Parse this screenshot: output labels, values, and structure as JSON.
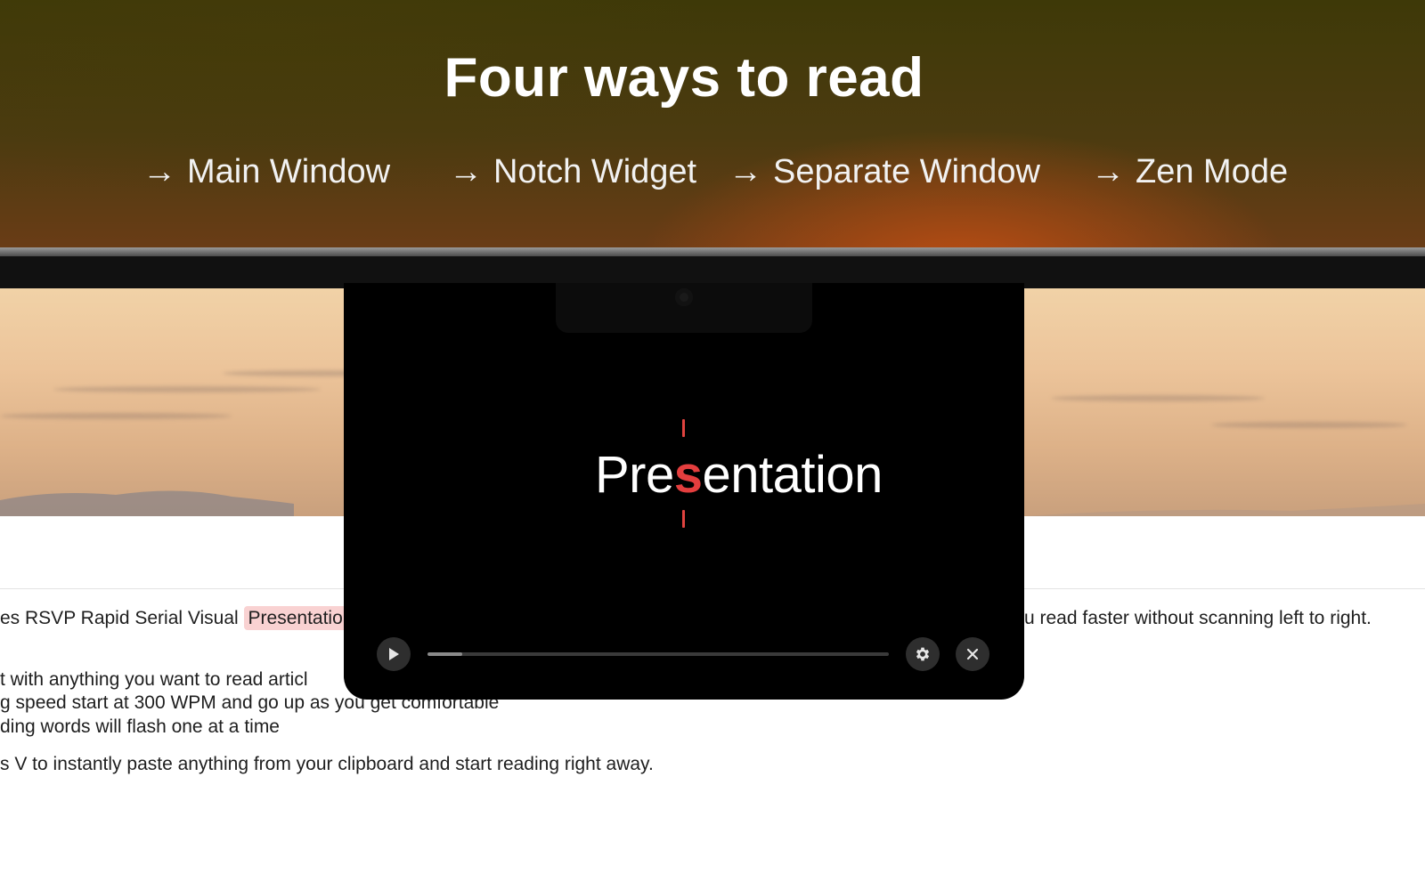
{
  "hero": {
    "title": "Four ways to read",
    "modes": [
      {
        "arrow": "→",
        "label": "Main Window"
      },
      {
        "arrow": "→",
        "label": "Notch Widget"
      },
      {
        "arrow": "→",
        "label": "Separate Window"
      },
      {
        "arrow": "→",
        "label": "Zen Mode"
      }
    ]
  },
  "document": {
    "line1_before": "es RSVP Rapid Serial Visual ",
    "line1_highlight": "Presentatio",
    "line1_after": "u read faster without scanning left to right.",
    "line2": "t with anything you want to read articl",
    "line3": "g speed start at 300 WPM and go up as you get comfortable",
    "line4": "ding words will flash one at a time",
    "line5": "s V to instantly paste anything from your clipboard and start reading right away."
  },
  "reader": {
    "word_before": "Pre",
    "word_focus": "s",
    "word_after": "entation",
    "progress": 0.075,
    "icons": {
      "play": "play-icon",
      "settings": "gear-icon",
      "close": "close-icon"
    },
    "colors": {
      "focus": "#e43e3e",
      "panel": "#000000"
    }
  }
}
